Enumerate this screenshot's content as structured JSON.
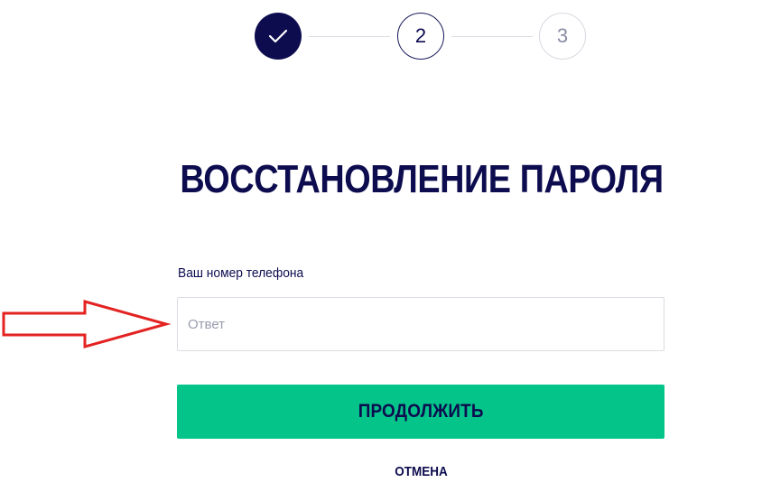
{
  "stepper": {
    "steps": [
      {
        "label": "",
        "state": "completed",
        "icon": "check-icon"
      },
      {
        "label": "2",
        "state": "current"
      },
      {
        "label": "3",
        "state": "upcoming"
      }
    ]
  },
  "page": {
    "title": "ВОССТАНОВЛЕНИЕ ПАРОЛЯ"
  },
  "form": {
    "phone_label": "Ваш номер телефона",
    "phone_value": "",
    "phone_placeholder": "Ответ",
    "submit_label": "ПРОДОЛЖИТЬ",
    "cancel_label": "ОТМЕНА"
  },
  "annotation": {
    "icon": "right-arrow-icon",
    "color": "#e32322"
  },
  "colors": {
    "primary": "#0d0c4f",
    "accent": "#04c489",
    "border": "#dcdde3",
    "muted": "#8a8ca3"
  }
}
